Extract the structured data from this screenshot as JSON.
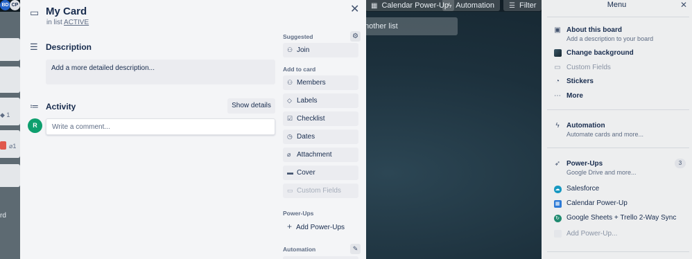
{
  "board": {
    "header_buttons": [
      {
        "icon": "calendar-icon",
        "label": "Calendar Power-Up"
      },
      {
        "icon": "lightning-icon",
        "label": "Automation"
      },
      {
        "icon": "filter-icon",
        "label": "Filter"
      }
    ],
    "another_list_label": "nother list",
    "left_avatars": [
      "BD",
      "CP"
    ],
    "left_fragments": {
      "count_1": "1",
      "count_2": "1",
      "bottom_text": "rd"
    }
  },
  "card": {
    "title": "My Card",
    "in_list_prefix": "in list",
    "list_name": "ACTIVE",
    "description_heading": "Description",
    "description_placeholder": "Add a more detailed description...",
    "activity_heading": "Activity",
    "show_details_label": "Show details",
    "user_initial": "R",
    "comment_placeholder": "Write a comment..."
  },
  "sidebar": {
    "suggested_label": "Suggested",
    "join_label": "Join",
    "add_to_card_label": "Add to card",
    "add_to_card_items": [
      {
        "icon": "person-icon",
        "label": "Members"
      },
      {
        "icon": "tag-icon",
        "label": "Labels"
      },
      {
        "icon": "checklist-icon",
        "label": "Checklist"
      },
      {
        "icon": "clock-icon",
        "label": "Dates"
      },
      {
        "icon": "paperclip-icon",
        "label": "Attachment"
      },
      {
        "icon": "cover-icon",
        "label": "Cover"
      },
      {
        "icon": "custom-fields-icon",
        "label": "Custom Fields"
      }
    ],
    "powerups_label": "Power-Ups",
    "add_powerups_label": "Add Power-Ups",
    "automation_label": "Automation"
  },
  "menu": {
    "title": "Menu",
    "about_title": "About this board",
    "about_sub": "Add a description to your board",
    "change_bg": "Change background",
    "custom_fields": "Custom Fields",
    "stickers": "Stickers",
    "more": "More",
    "automation_title": "Automation",
    "automation_sub": "Automate cards and more...",
    "powerups_title": "Power-Ups",
    "powerups_sub": "Google Drive and more...",
    "powerups_count": "3",
    "powerups": [
      "Salesforce",
      "Calendar Power-Up",
      "Google Sheets + Trello 2-Way Sync"
    ],
    "add_powerup": "Add Power-Up..."
  },
  "colors": {
    "accent_green": "#0e9f6e",
    "salesforce_blue": "#1798c1",
    "calendar_blue": "#2d7ad6",
    "sheets_teal": "#1f8a6f"
  }
}
